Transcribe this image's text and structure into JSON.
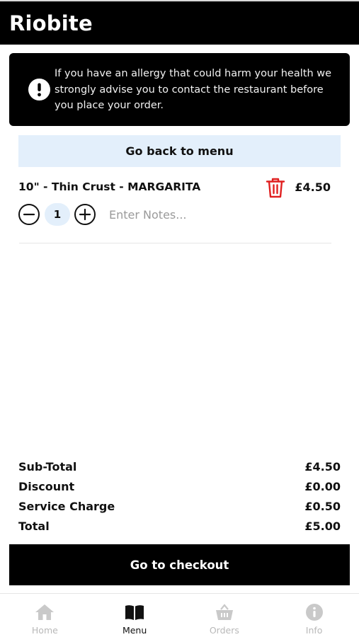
{
  "header": {
    "title": "Riobite"
  },
  "allergy_notice": {
    "icon": "alert-icon",
    "text": "If you have an allergy that could harm your health we strongly advise you to contact the restaurant before you place your order."
  },
  "back_button_label": "Go back to menu",
  "cart": {
    "items": [
      {
        "name": "10\" - Thin Crust - MARGARITA",
        "price": "£4.50",
        "quantity": "1",
        "notes_value": "",
        "notes_placeholder": "Enter Notes..."
      }
    ]
  },
  "totals": {
    "subtotal_label": "Sub-Total",
    "subtotal_value": "£4.50",
    "discount_label": "Discount",
    "discount_value": "£0.00",
    "service_label": "Service Charge",
    "service_value": "£0.50",
    "total_label": "Total",
    "total_value": "£5.00"
  },
  "checkout_label": "Go to checkout",
  "nav": {
    "active": "Menu",
    "items": [
      {
        "label": "Home",
        "icon": "home-icon"
      },
      {
        "label": "Menu",
        "icon": "book-icon"
      },
      {
        "label": "Orders",
        "icon": "basket-icon"
      },
      {
        "label": "Info",
        "icon": "info-icon"
      }
    ]
  },
  "colors": {
    "header_bg": "#000000",
    "accent_light_blue": "#e3effb",
    "delete_red": "#e02020",
    "nav_inactive": "#b8b8b8"
  }
}
